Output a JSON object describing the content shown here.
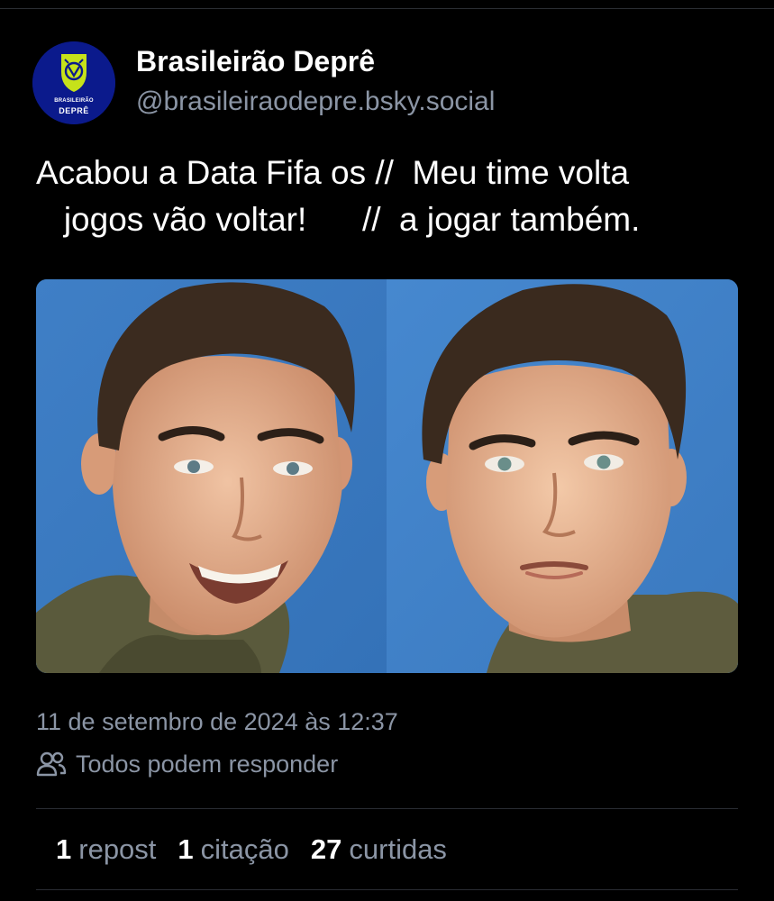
{
  "author": {
    "display_name": "Brasileirão Deprê",
    "handle": "@brasileiraodepre.bsky.social",
    "avatar_icon": "brasileirao-depre-logo",
    "avatar_text_top": "BRASILEIRÃO",
    "avatar_text_bottom": "DEPRÊ",
    "avatar_bg": "#0b1a8c",
    "avatar_accent": "#c6e21a"
  },
  "post": {
    "text_line_1": "Acabou a Data Fifa os //  Meu time volta",
    "text_line_2": "   jogos vão voltar!      //  a jogar também.",
    "image_icon": "two-portraits-meme-image",
    "timestamp": "11 de setembro de 2024 às 12:37",
    "reply_setting_icon": "people-icon",
    "reply_setting": "Todos podem responder"
  },
  "stats": {
    "reposts_count": "1",
    "reposts_label": "repost",
    "quotes_count": "1",
    "quotes_label": "citação",
    "likes_count": "27",
    "likes_label": "curtidas"
  },
  "colors": {
    "background": "#000000",
    "text_primary": "#ffffff",
    "text_secondary": "#8b95a5",
    "divider": "#2a2d33",
    "image_bg": "#3f83cc"
  }
}
